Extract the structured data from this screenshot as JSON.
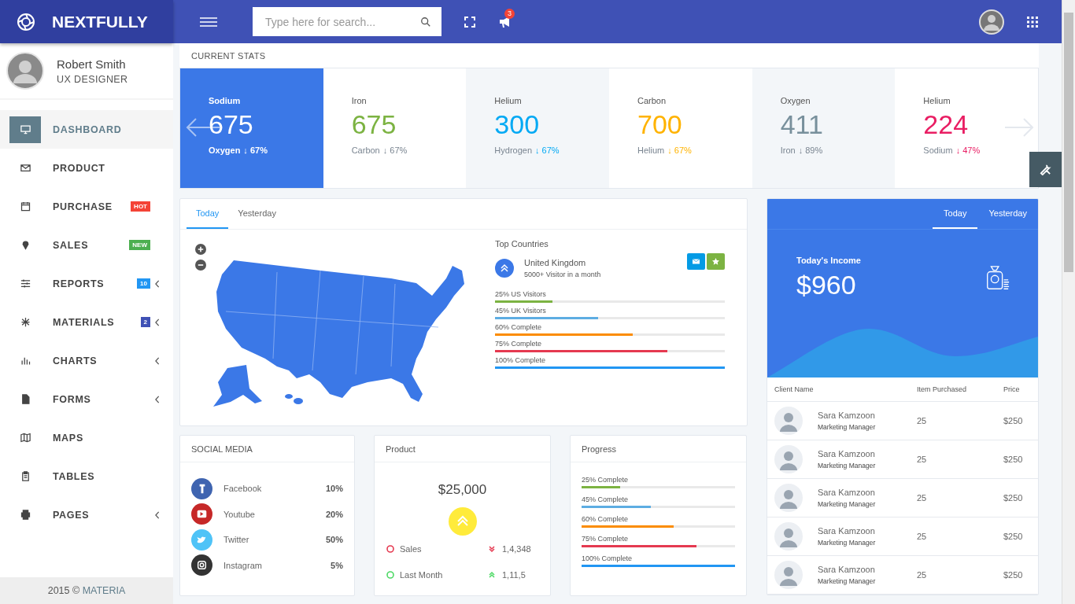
{
  "brand": {
    "name": "NEXTFULLY"
  },
  "topbar": {
    "search_placeholder": "Type here for search...",
    "notification_count": "3"
  },
  "user": {
    "name": "Robert Smith",
    "role": "UX DESIGNER"
  },
  "sidebar": {
    "items": [
      {
        "label": "DASHBOARD",
        "selected": true,
        "expandable": false
      },
      {
        "label": "PRODUCT",
        "selected": false,
        "expandable": false
      },
      {
        "label": "PURCHASE",
        "selected": false,
        "expandable": false,
        "badge": {
          "text": "HOT",
          "color": "#f44336"
        }
      },
      {
        "label": "SALES",
        "selected": false,
        "expandable": false,
        "badge": {
          "text": "NEW",
          "color": "#4caf50"
        }
      },
      {
        "label": "REPORTS",
        "selected": false,
        "expandable": true,
        "badge": {
          "text": "10",
          "color": "#2196f3"
        }
      },
      {
        "label": "MATERIALS",
        "selected": false,
        "expandable": true,
        "badge": {
          "text": "2",
          "color": "#3f51b5"
        }
      },
      {
        "label": "CHARTS",
        "selected": false,
        "expandable": true
      },
      {
        "label": "FORMS",
        "selected": false,
        "expandable": true
      },
      {
        "label": "MAPS",
        "selected": false,
        "expandable": false
      },
      {
        "label": "TABLES",
        "selected": false,
        "expandable": false
      },
      {
        "label": "PAGES",
        "selected": false,
        "expandable": true
      }
    ]
  },
  "footer": {
    "text": "2015 ©",
    "link": "MATERIA"
  },
  "stats": {
    "title": "CURRENT STATS",
    "items": [
      {
        "name": "Sodium",
        "value": "675",
        "sub_label": "Oxygen",
        "change": "↓ 67%",
        "selected": true
      },
      {
        "name": "Iron",
        "value": "675",
        "sub_label": "Carbon",
        "change": "↓ 67%",
        "color": "#7cb342",
        "change_highlighted": false,
        "selected": false
      },
      {
        "name": "Helium",
        "value": "300",
        "sub_label": "Hydrogen",
        "change": "↓ 67%",
        "color": "#03a9f4",
        "change_highlighted": true,
        "selected": false
      },
      {
        "name": "Carbon",
        "value": "700",
        "sub_label": "Helium",
        "change": "↓ 67%",
        "color": "#ffb300",
        "change_highlighted": true,
        "selected": false
      },
      {
        "name": "Oxygen",
        "value": "411",
        "sub_label": "Iron",
        "change": "↓ 89%",
        "color": "#78909c",
        "change_highlighted": false,
        "selected": false
      },
      {
        "name": "Helium",
        "value": "224",
        "sub_label": "Sodium",
        "change": "↓ 47%",
        "color": "#e91e63",
        "change_highlighted": true,
        "selected": false
      }
    ]
  },
  "map_card": {
    "tabs": [
      {
        "label": "Today",
        "selected": true
      },
      {
        "label": "Yesterday",
        "selected": false
      }
    ],
    "top_countries": {
      "title": "Top Countries",
      "country": "United Kingdom",
      "visitors": "5000+ Visitor in a month"
    },
    "bars": [
      {
        "label": "25% US Visitors",
        "level": 0.25,
        "color": "#7cb342"
      },
      {
        "label": "45% UK Visitors",
        "level": 0.45,
        "color": "#5dade2"
      },
      {
        "label": "60% Complete",
        "level": 0.6,
        "color": "#fb8c00"
      },
      {
        "label": "75% Complete",
        "level": 0.75,
        "color": "#e53950"
      },
      {
        "label": "100% Complete",
        "level": 1,
        "color": "#2196f3"
      }
    ]
  },
  "social_media": {
    "title": "SOCIAL MEDIA",
    "items": [
      {
        "kind": "facebook",
        "name": "Facebook",
        "percent": "10%"
      },
      {
        "kind": "youtube",
        "name": "Youtube",
        "percent": "20%"
      },
      {
        "kind": "twitter",
        "name": "Twitter",
        "percent": "50%"
      },
      {
        "kind": "instagram",
        "name": "Instagram",
        "percent": "5%"
      }
    ]
  },
  "product": {
    "title": "Product",
    "amount": "$25,000",
    "rows": [
      {
        "label": "Sales",
        "kind": "down",
        "value": "1,4,348",
        "color": "#e53950"
      },
      {
        "label": "Last Month",
        "kind": "up",
        "value": "1,11,5",
        "color": "#4cd964"
      }
    ]
  },
  "progress": {
    "title": "Progress",
    "bars": [
      {
        "label": "25% Complete",
        "level": 0.25,
        "color": "#7cb342"
      },
      {
        "label": "45% Complete",
        "level": 0.45,
        "color": "#5dade2"
      },
      {
        "label": "60% Complete",
        "level": 0.6,
        "color": "#fb8c00"
      },
      {
        "label": "75% Complete",
        "level": 0.75,
        "color": "#e53950"
      },
      {
        "label": "100% Complete",
        "level": 1,
        "color": "#2196f3"
      }
    ]
  },
  "income": {
    "tabs": [
      {
        "label": "Today",
        "selected": true
      },
      {
        "label": "Yesterday",
        "selected": false
      }
    ],
    "label": "Today's Income",
    "amount": "$960",
    "columns": [
      "Client Name",
      "Item Purchased",
      "Price"
    ],
    "rows": [
      {
        "name": "Sara Kamzoon",
        "role": "Marketing Manager",
        "items": "25",
        "price": "$250"
      },
      {
        "name": "Sara Kamzoon",
        "role": "Marketing Manager",
        "items": "25",
        "price": "$250"
      },
      {
        "name": "Sara Kamzoon",
        "role": "Marketing Manager",
        "items": "25",
        "price": "$250"
      },
      {
        "name": "Sara Kamzoon",
        "role": "Marketing Manager",
        "items": "25",
        "price": "$250"
      },
      {
        "name": "Sara Kamzoon",
        "role": "Marketing Manager",
        "items": "25",
        "price": "$250"
      }
    ]
  }
}
